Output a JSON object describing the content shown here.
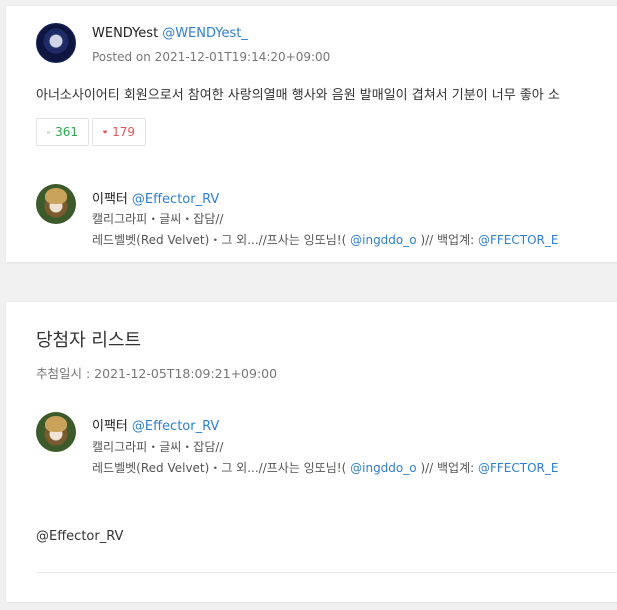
{
  "post": {
    "author_name": "WENDYest",
    "author_handle": "@WENDYest_",
    "posted_on": "Posted on 2021-12-01T19:14:20+09:00",
    "text": "아너소사이어티 회원으로서 참여한 사랑의열매 행사와 음원 발매일이 겹쳐서 기분이 너무 좋아 소",
    "retweets": "361",
    "likes": "179"
  },
  "profile": {
    "name": "이팩터",
    "handle": "@Effector_RV",
    "bio_line1": "캘리그라피・글씨・잡담//",
    "bio_line2_prefix": "레드벨벳(Red Velvet)・그 외...//프사는 잉또님!(",
    "bio_link1": "@ingddo_o",
    "bio_line2_mid": ")// 백업계: ",
    "bio_link2": "@FFECTOR_E"
  },
  "winners": {
    "title": "당첨자 리스트",
    "drawn_at": "추첨일시 : 2021-12-05T18:09:21+09:00",
    "entries": [
      "@Effector_RV"
    ]
  },
  "colors": {
    "link": "#2f7fd1",
    "retweet": "#2ea84f",
    "like": "#e05555"
  },
  "icons": {
    "retweet": "retweet-icon",
    "like": "heart-icon"
  }
}
